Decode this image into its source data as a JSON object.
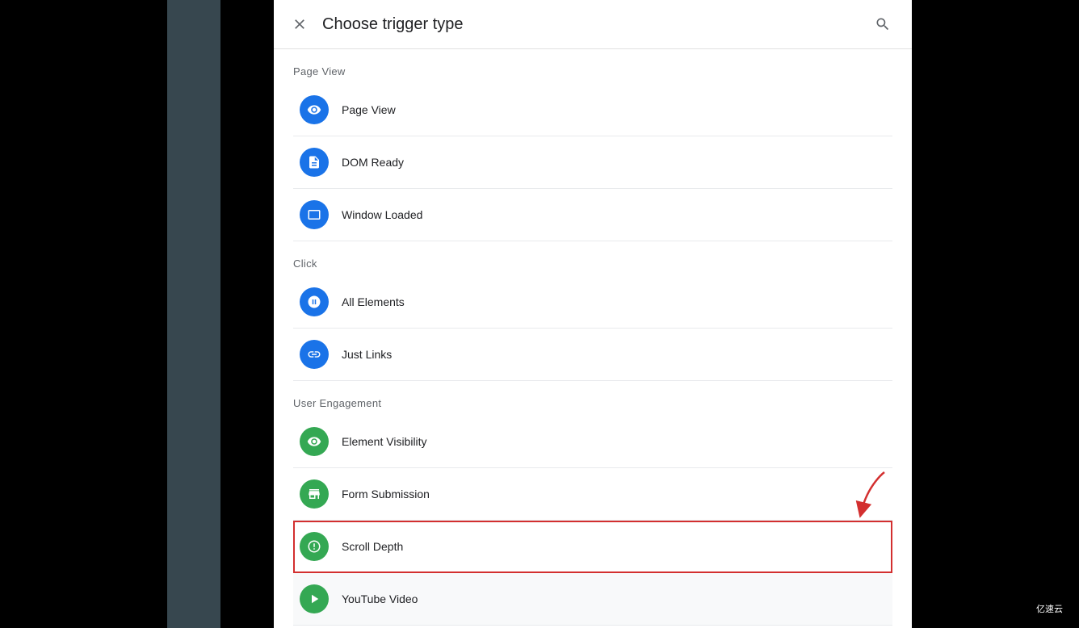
{
  "modal": {
    "title": "Choose trigger type",
    "close_label": "×",
    "sections": [
      {
        "id": "page-view",
        "header": "Page View",
        "items": [
          {
            "id": "page-view-item",
            "label": "Page View",
            "icon": "eye",
            "color": "blue"
          },
          {
            "id": "dom-ready-item",
            "label": "DOM Ready",
            "icon": "doc",
            "color": "blue"
          },
          {
            "id": "window-loaded-item",
            "label": "Window Loaded",
            "icon": "window",
            "color": "blue"
          }
        ]
      },
      {
        "id": "click",
        "header": "Click",
        "items": [
          {
            "id": "all-elements-item",
            "label": "All Elements",
            "icon": "cursor",
            "color": "blue"
          },
          {
            "id": "just-links-item",
            "label": "Just Links",
            "icon": "link",
            "color": "blue"
          }
        ]
      },
      {
        "id": "user-engagement",
        "header": "User Engagement",
        "items": [
          {
            "id": "element-visibility-item",
            "label": "Element Visibility",
            "icon": "eye2",
            "color": "green"
          },
          {
            "id": "form-submission-item",
            "label": "Form Submission",
            "icon": "form",
            "color": "green"
          },
          {
            "id": "scroll-depth-item",
            "label": "Scroll Depth",
            "icon": "scroll",
            "color": "green",
            "highlighted": true
          },
          {
            "id": "youtube-video-item",
            "label": "YouTube Video",
            "icon": "play",
            "color": "green"
          }
        ]
      }
    ]
  },
  "watermark": "亿速云"
}
